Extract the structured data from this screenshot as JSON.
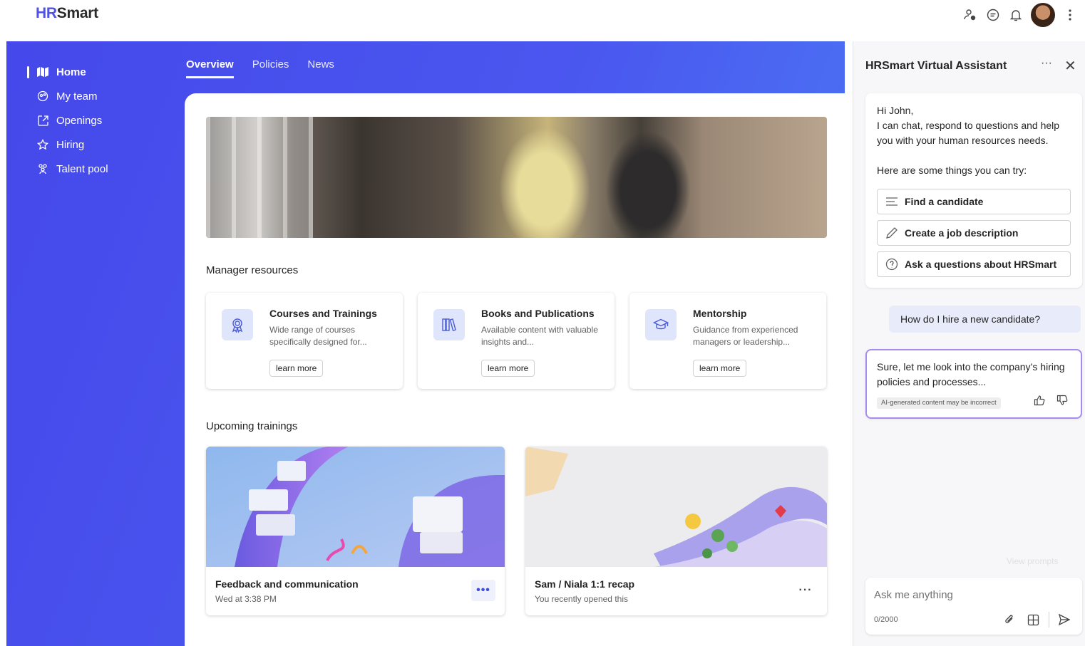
{
  "app": {
    "logo_prefix": "HR",
    "logo_suffix": "Smart"
  },
  "topbar": {
    "icons": [
      "people-settings-icon",
      "chat-icon",
      "bell-icon",
      "avatar",
      "more-vertical-icon"
    ]
  },
  "sidebar": {
    "items": [
      {
        "label": "Home",
        "icon": "map-icon",
        "active": true
      },
      {
        "label": "My team",
        "icon": "team-icon"
      },
      {
        "label": "Openings",
        "icon": "open-icon"
      },
      {
        "label": "Hiring",
        "icon": "star-icon"
      },
      {
        "label": "Talent pool",
        "icon": "people-icon"
      }
    ]
  },
  "tabs": [
    {
      "label": "Overview",
      "active": true
    },
    {
      "label": "Policies"
    },
    {
      "label": "News"
    }
  ],
  "manager_resources": {
    "title": "Manager resources",
    "cards": [
      {
        "title": "Courses and Trainings",
        "desc": "Wide range of courses specifically designed for...",
        "button": "learn more",
        "icon": "ribbon-icon"
      },
      {
        "title": "Books and Publications",
        "desc": "Available content with valuable insights and...",
        "button": "learn more",
        "icon": "library-icon"
      },
      {
        "title": "Mentorship",
        "desc": "Guidance from experienced managers or leadership...",
        "button": "learn more",
        "icon": "hat-graduation-icon"
      }
    ]
  },
  "upcoming": {
    "title": "Upcoming trainings",
    "cards": [
      {
        "title": "Feedback and communication",
        "sub": "Wed at 3:38 PM",
        "more": "•••"
      },
      {
        "title": "Sam / Niala 1:1 recap",
        "sub": "You recently opened this",
        "more": "···"
      }
    ]
  },
  "assistant": {
    "title": "HRSmart Virtual Assistant",
    "more": "···",
    "close": "✕",
    "greeting": "Hi John,",
    "intro": "I can chat, respond to questions and help you with your human resources needs.",
    "try_text": "Here are some things you can try:",
    "suggestions": [
      {
        "label": "Find a candidate",
        "icon": "text-align-icon"
      },
      {
        "label": "Create a job description",
        "icon": "pen-icon"
      },
      {
        "label": "Ask a questions about HRSmart",
        "icon": "chat-help-icon"
      }
    ],
    "user_message": "How do I hire a new candidate?",
    "bot_message": "Sure, let me look into the company’s hiring policies and processes...",
    "ai_badge": "AI-generated content may be incorrect",
    "view_prompts": "View prompts",
    "input_placeholder": "Ask me anything",
    "counter": "0/2000"
  },
  "colors": {
    "accent": "#4f52e8",
    "gradient_start": "#4548ea",
    "gradient_end": "#4c7df5",
    "bot_border": "#a78bf0"
  }
}
